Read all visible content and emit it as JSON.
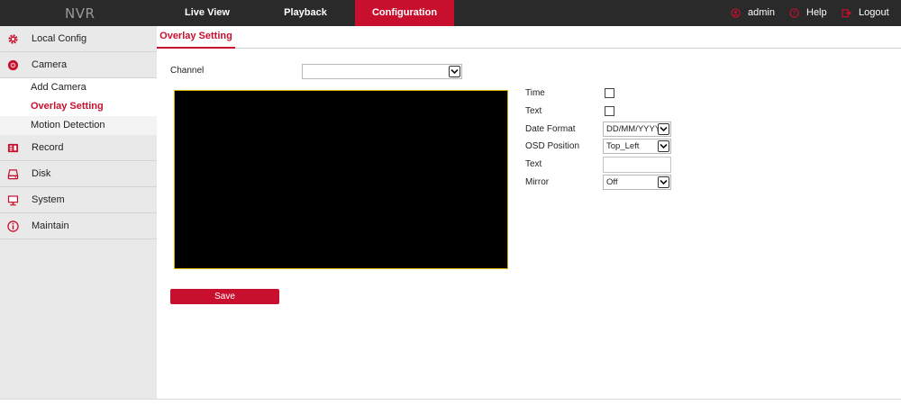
{
  "app": {
    "logo": "NVR"
  },
  "nav": {
    "tabs": [
      {
        "label": "Live View"
      },
      {
        "label": "Playback"
      },
      {
        "label": "Configuration"
      }
    ],
    "user": {
      "label": "admin",
      "icon": "user-icon"
    },
    "help": {
      "label": "Help",
      "icon": "help-icon"
    },
    "logout": {
      "label": "Logout",
      "icon": "logout-icon"
    }
  },
  "sidebar": {
    "items": [
      {
        "label": "Local Config",
        "icon": "gear-icon"
      },
      {
        "label": "Camera",
        "icon": "camera-icon"
      },
      {
        "label": "Record",
        "icon": "record-icon"
      },
      {
        "label": "Disk",
        "icon": "disk-icon"
      },
      {
        "label": "System",
        "icon": "monitor-icon"
      },
      {
        "label": "Maintain",
        "icon": "info-icon"
      }
    ],
    "camera_sub": [
      {
        "label": "Add Camera"
      },
      {
        "label": "Overlay Setting"
      },
      {
        "label": "Motion Detection"
      }
    ]
  },
  "main": {
    "tab": "Overlay Setting",
    "channel": {
      "label": "Channel",
      "value": ""
    },
    "settings": {
      "time_label": "Time",
      "text_label": "Text",
      "date_format_label": "Date Format",
      "date_format_value": "DD/MM/YYYY",
      "osd_position_label": "OSD Position",
      "osd_position_value": "Top_Left",
      "text_input_label": "Text",
      "text_input_value": "",
      "mirror_label": "Mirror",
      "mirror_value": "Off"
    },
    "save_label": "Save"
  },
  "colors": {
    "accent": "#c8102e",
    "topbar": "#2a2a2a",
    "sidebar": "#e9e9e9",
    "preview_border": "#d4b000"
  }
}
